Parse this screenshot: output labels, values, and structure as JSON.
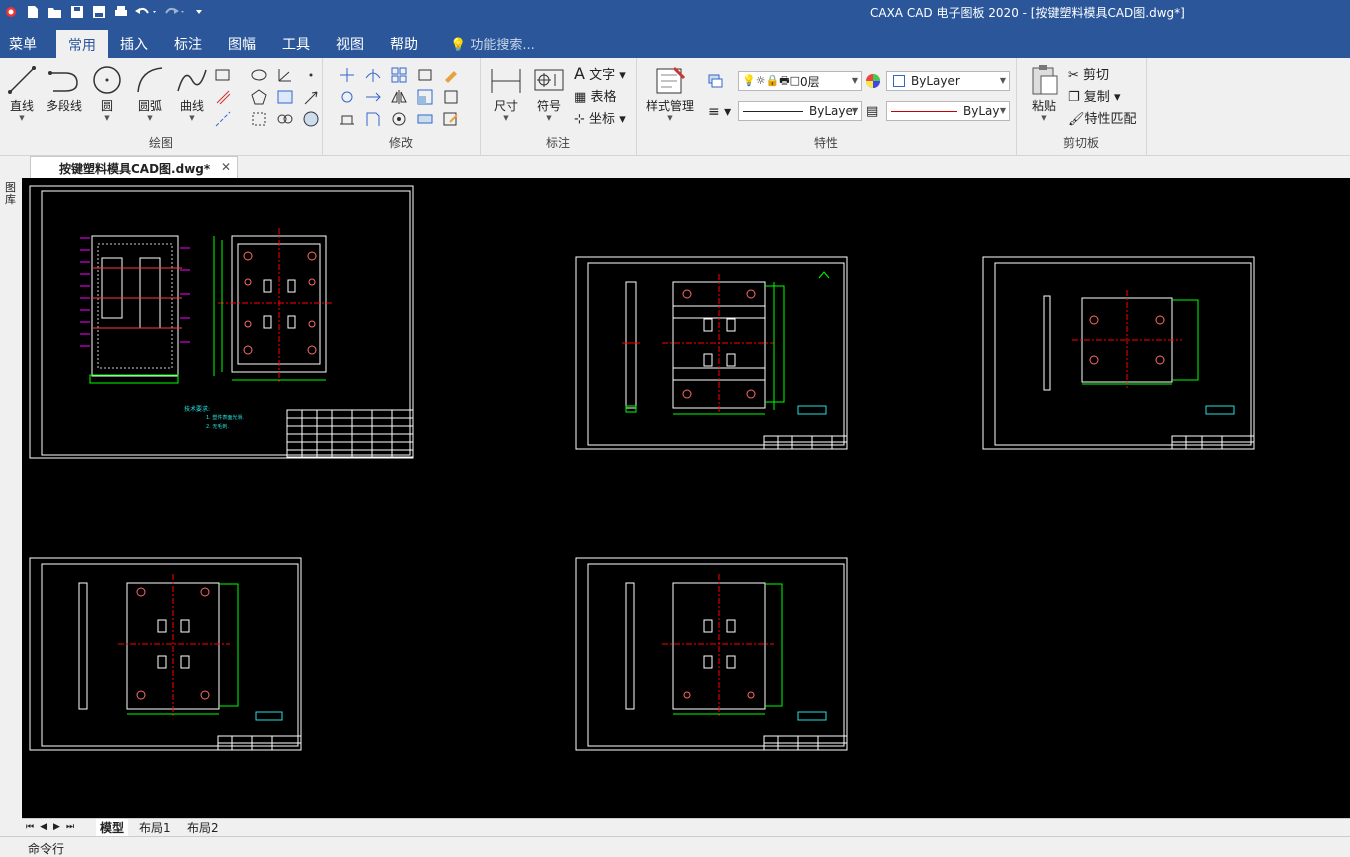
{
  "window": {
    "title": "CAXA CAD 电子图板 2020 - [按键塑料模具CAD图.dwg*]"
  },
  "menu": {
    "items": [
      "菜单",
      "常用",
      "插入",
      "标注",
      "图幅",
      "工具",
      "视图",
      "帮助"
    ],
    "active": "常用",
    "search_placeholder": "功能搜索..."
  },
  "ribbon": {
    "draw": {
      "label": "绘图",
      "tools": [
        "直线",
        "多段线",
        "圆",
        "圆弧",
        "曲线"
      ]
    },
    "modify": {
      "label": "修改"
    },
    "annotate": {
      "label": "标注",
      "dim": "尺寸",
      "symbol": "符号",
      "text": "文字",
      "table": "表格",
      "coord": "坐标"
    },
    "properties": {
      "label": "特性",
      "style_manager": "样式管理",
      "layer": "0层",
      "color": "ByLayer",
      "linetype": "ByLayer",
      "lineweight": "ByLay"
    },
    "clipboard": {
      "label": "剪切板",
      "paste": "粘贴",
      "cut": "剪切",
      "copy": "复制",
      "match": "特性匹配"
    }
  },
  "document_tab": {
    "name": "按键塑料模具CAD图.dwg*"
  },
  "left_strip": {
    "label": "图库"
  },
  "layout_tabs": [
    "模型",
    "布局1",
    "布局2"
  ],
  "command_line": {
    "label": "命令行"
  },
  "drawing": {
    "tech_title": "技术要求:",
    "tech_notes": [
      "1. 塑件表面光滑.",
      "2. 无毛刺."
    ]
  },
  "colors": {
    "accent": "#2b579a",
    "canvas": "#000000",
    "frame": "#ffffff",
    "center_line": "#ff0000",
    "dim": "#00ff00",
    "annot": "#ff00ff",
    "hole": "#ff6a6a"
  }
}
